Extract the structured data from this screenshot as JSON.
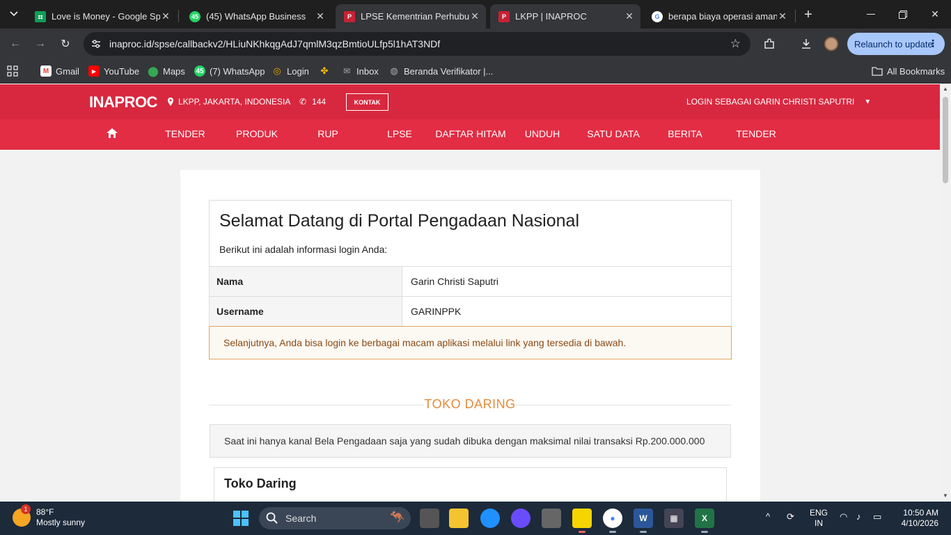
{
  "browser": {
    "tabs": [
      {
        "title": "Love is Money - Google Spre",
        "favicon": "sheets-icon"
      },
      {
        "title": "(45) WhatsApp Business",
        "favicon": "whatsapp-icon"
      },
      {
        "title": "LPSE Kementrian Perhubung",
        "favicon": "inaproc-icon"
      },
      {
        "title": "LKPP | INAPROC",
        "favicon": "inaproc-icon"
      },
      {
        "title": "berapa biaya operasi amand",
        "favicon": "google-icon"
      }
    ],
    "url": "inaproc.id/spse/callbackv2/HLiuNKhkqgAdJ7qmlM3qzBmtioULfp5l1hAT3NDf",
    "relaunch_label": "Relaunch to update",
    "bookmarks": [
      {
        "label": "Gmail"
      },
      {
        "label": "YouTube"
      },
      {
        "label": "Maps"
      },
      {
        "label": "(7) WhatsApp"
      },
      {
        "label": "Login"
      },
      {
        "label": ""
      },
      {
        "label": "Inbox"
      },
      {
        "label": "Beranda Verifikator |..."
      }
    ],
    "all_bookmarks": "All Bookmarks",
    "whatsapp_badge": "45"
  },
  "site": {
    "logo": "INAPROC",
    "location": "LKPP, JAKARTA, INDONESIA",
    "phone": "144",
    "contact_label": "KONTAK",
    "login_as": "LOGIN SEBAGAI GARIN CHRISTI SAPUTRI",
    "nav": [
      "TENDER",
      "PRODUK",
      "RUP",
      "LPSE",
      "DAFTAR HITAM",
      "UNDUH",
      "SATU DATA",
      "BERITA",
      "TENDER"
    ],
    "accent": "#d8283f"
  },
  "welcome": {
    "title": "Selamat Datang di Portal Pengadaan Nasional",
    "subtitle": "Berikut ini adalah informasi login Anda:",
    "rows": [
      {
        "key": "Nama",
        "value": "Garin Christi Saputri"
      },
      {
        "key": "Username",
        "value": "GARINPPK"
      }
    ],
    "notice": "Selanjutnya, Anda bisa login ke berbagai macam aplikasi melalui link yang tersedia di bawah."
  },
  "toko": {
    "section_label": "TOKO DARING",
    "info": "Saat ini hanya kanal Bela Pengadaan saja yang sudah dibuka dengan maksimal nilai transaksi Rp.200.000.000",
    "card_title": "Toko Daring"
  },
  "taskbar": {
    "weather_temp": "88°F",
    "weather_desc": "Mostly sunny",
    "weather_badge": "1",
    "search_placeholder": "Search",
    "lang_1": "ENG",
    "lang_2": "IN",
    "time": "10:50 AM",
    "date": "4/10/2026"
  }
}
